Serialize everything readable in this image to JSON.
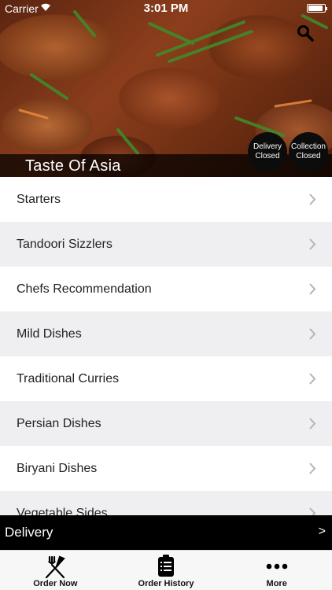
{
  "status_bar": {
    "carrier": "Carrier",
    "time": "3:01 PM",
    "battery_level": 0.92
  },
  "header": {
    "restaurant_name": "Taste Of Asia",
    "delivery_status": {
      "line1": "Delivery",
      "line2": "Closed"
    },
    "collection_status": {
      "line1": "Collection",
      "line2": "Closed"
    }
  },
  "menu": {
    "categories": [
      {
        "label": "Starters"
      },
      {
        "label": "Tandoori Sizzlers"
      },
      {
        "label": "Chefs Recommendation"
      },
      {
        "label": "Mild Dishes"
      },
      {
        "label": "Traditional Curries"
      },
      {
        "label": "Persian Dishes"
      },
      {
        "label": "Biryani Dishes"
      },
      {
        "label": "Vegetable Sides"
      }
    ]
  },
  "delivery_bar": {
    "label": "Delivery",
    "arrow": ">"
  },
  "tab_bar": {
    "tabs": [
      {
        "label": "Order Now",
        "icon": "fork-knife-icon"
      },
      {
        "label": "Order History",
        "icon": "clipboard-icon"
      },
      {
        "label": "More",
        "icon": "more-dots-icon"
      }
    ]
  },
  "colors": {
    "title_bar": "#000000",
    "row_alt": "#efeff1",
    "delivery_bar": "#000000",
    "tab_bar": "#f7f7f7"
  }
}
